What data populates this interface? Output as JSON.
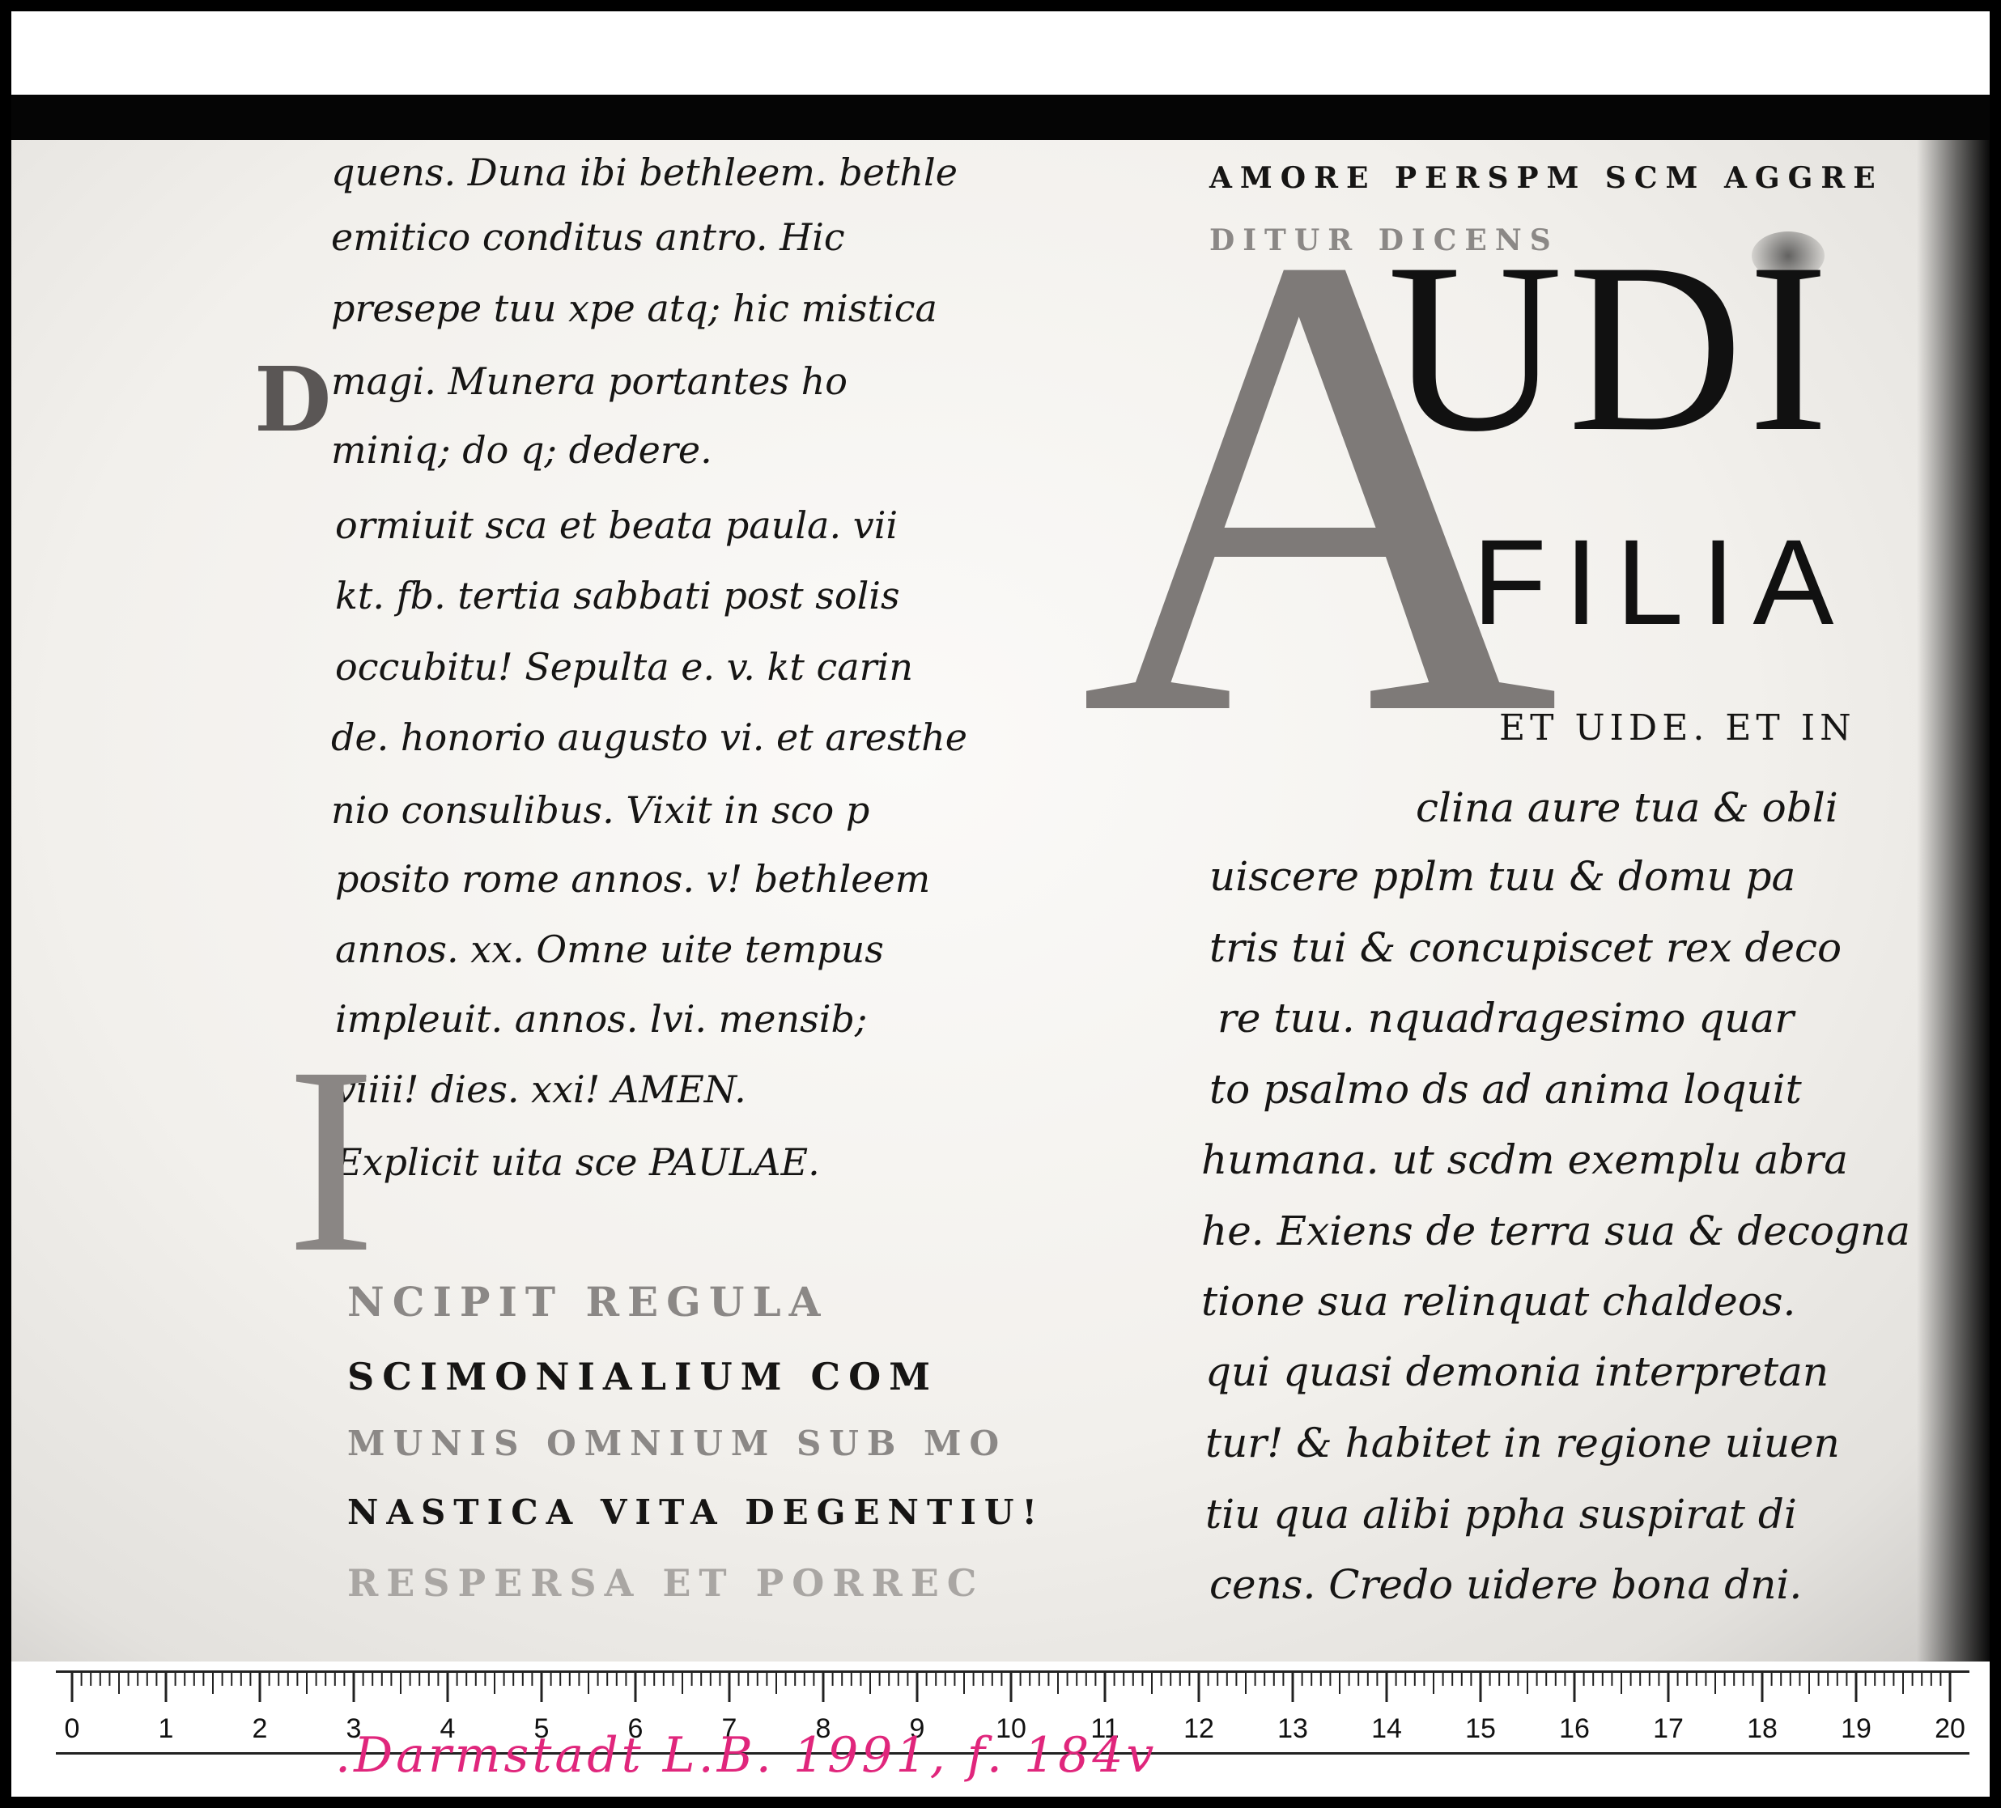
{
  "left_column": {
    "lines": [
      "quens. Duna ibi bethleem. bethle",
      "emitico conditus antro. Hic",
      "presepe tuu xpe atq; hic mistica",
      "magi. Munera portantes ho",
      "miniq; do q; dedere.",
      "ormiuit sca et beata paula. vii",
      "kt. fb. tertia sabbati post solis",
      "occubitu! Sepulta e. v. kt carin",
      "de. honorio augusto vi. et aresthe",
      "nio consulibus. Vixit in sco p",
      "posito rome annos. v! bethleem",
      "annos. xx. Omne uite tempus",
      "impleuit. annos. lvi. mensib;",
      "viiii! dies. xxi! AMEN.",
      "Explicit uita sce PAULAE."
    ],
    "initial_o": "D",
    "initial_i": "I",
    "rubric_lines": [
      "NCIPIT REGULA",
      "SCIMONIALIUM COM",
      "MUNIS OMNIUM SUB MO",
      "NASTICA VITA DEGENTIU!",
      "RESPERSA ET PORREC"
    ]
  },
  "right_column": {
    "rubric_lines": [
      "AMORE PERSPM SCM AGGRE",
      "DITUR DICENS"
    ],
    "initial_a": "A",
    "display_audi": "UDI",
    "display_filia": "FILIA",
    "display_et": "ET UIDE. ET IN",
    "lines": [
      "clina aure tua & obli",
      "uiscere pplm tuu & domu pa",
      "tris tui & concupiscet rex deco",
      "re tuu.   nquadragesimo quar",
      "to psalmo ds ad anima loquit",
      "humana. ut scdm exemplu abra",
      "he. Exiens de terra sua & decogna",
      "tione sua relinquat chaldeos.",
      "qui quasi demonia interpretan",
      "tur! & habitet in regione uiuen",
      "tiu qua alibi ppha suspirat di",
      "cens. Credo uidere bona dni."
    ]
  },
  "ruler": {
    "numbers": [
      "0",
      "1",
      "2",
      "3",
      "4",
      "5",
      "6",
      "7",
      "8",
      "9",
      "10",
      "11",
      "12",
      "13",
      "14",
      "15",
      "16",
      "17",
      "18",
      "19",
      "20"
    ]
  },
  "reference_note": ".Darmstadt L.B. 1991, f. 184v",
  "colors": {
    "ink": "#161514",
    "rubric": "#8b8886",
    "reference_note": "#e0267c",
    "frame": "#000000"
  }
}
